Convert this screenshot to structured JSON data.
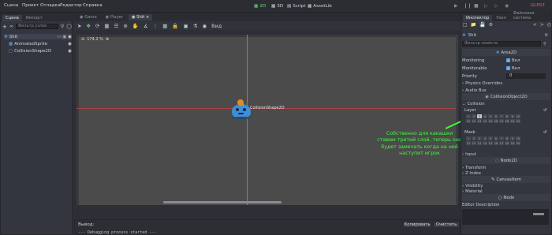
{
  "menu": [
    "Сцена",
    "Проект",
    "Отладка",
    "Редактор",
    "Справка"
  ],
  "workspaces": [
    {
      "label": "2D",
      "active": true
    },
    {
      "label": "3D",
      "active": false
    },
    {
      "label": "Script",
      "active": false
    },
    {
      "label": "AssetLib",
      "active": false
    }
  ],
  "renderer": "GLES3",
  "left_panel": {
    "tabs": [
      "Сцена",
      "Импорт"
    ],
    "filter_placeholder": "Фильтр узлов",
    "nodes": [
      "Shit",
      "AnimatedSprite",
      "CollisionShape2D"
    ]
  },
  "editor_tabs": [
    "Game",
    "Player",
    "Shit"
  ],
  "viewport": {
    "zoom": "174.2 %",
    "view_label": "Вид",
    "shape_label": "CollisionShape2D"
  },
  "annotation": "Собственно для какашки ставим третий слой, теперь она будет замечать когда на неё наступит игрок",
  "output": {
    "title": "Вывод:",
    "copy": "Копировать",
    "clear": "Очистить",
    "line": "--- Debugging process started ---"
  },
  "inspector": {
    "tabs": [
      "Инспектор",
      "Узел",
      "Файловая система"
    ],
    "node_name": "Shit",
    "filter_placeholder": "Фильтр свойств",
    "class_name": "Area2D",
    "monitoring_label": "Monitoring",
    "monitoring_value": "Вкл",
    "monitorable_label": "Monitorable",
    "monitorable_value": "Вкл",
    "priority_label": "Priority",
    "priority_value": "0",
    "physics_overrides": "Physics Overrides",
    "audio_bus": "Audio Bus",
    "collision_object": "CollisionObject2D",
    "collision": "Collision",
    "layer": "Layer",
    "mask": "Mask",
    "input": "Input",
    "node2d": "Node2D",
    "transform": "Transform",
    "z_index": "Z Index",
    "canvas_item": "CanvasItem",
    "visibility": "Visibility",
    "material": "Material",
    "node": "Node",
    "editor_description": "Editor Description",
    "layer_row1": [
      "1",
      "2",
      "3",
      "4",
      "5",
      "6",
      "7",
      "8",
      "9",
      "10"
    ],
    "layer_row2": [
      "11",
      "12",
      "13",
      "14",
      "15",
      "16",
      "17",
      "18",
      "19",
      "20"
    ],
    "mask_row1": [
      "1",
      "2",
      "3",
      "4",
      "5",
      "6",
      "7",
      "8",
      "9",
      "10"
    ],
    "mask_row2": [
      "11",
      "12",
      "13",
      "14",
      "15",
      "16",
      "17",
      "18",
      "19",
      "20"
    ]
  },
  "colors": {
    "accent_green": "#6fe07a",
    "annotation_green": "#39ff3a",
    "viewport_bg": "#4b4b4b",
    "slime_blue": "#3e8fd8"
  }
}
